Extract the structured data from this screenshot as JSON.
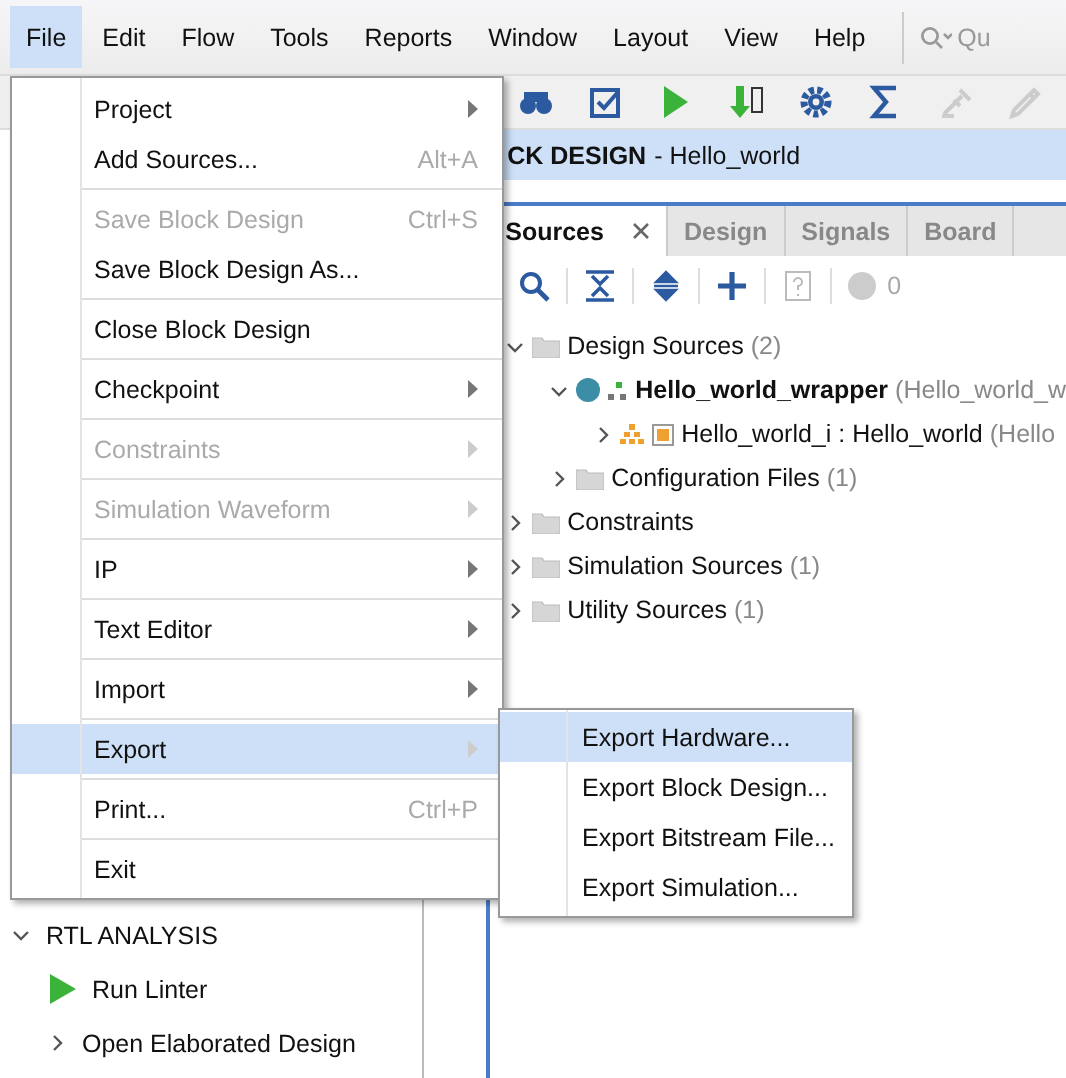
{
  "menubar": {
    "items": [
      {
        "label": "File",
        "selected": true
      },
      {
        "label": "Edit",
        "selected": false
      },
      {
        "label": "Flow",
        "selected": false
      },
      {
        "label": "Tools",
        "selected": false
      },
      {
        "label": "Reports",
        "selected": false
      },
      {
        "label": "Window",
        "selected": false
      },
      {
        "label": "Layout",
        "selected": false
      },
      {
        "label": "View",
        "selected": false
      },
      {
        "label": "Help",
        "selected": false
      }
    ],
    "search": {
      "placeholder": "Qu"
    }
  },
  "toolbar": [
    {
      "kind": "binoculars",
      "disabled": false
    },
    {
      "kind": "check",
      "disabled": false
    },
    {
      "kind": "run",
      "disabled": false
    },
    {
      "kind": "bitstream",
      "disabled": false
    },
    {
      "kind": "gear",
      "disabled": false
    },
    {
      "kind": "sigma",
      "disabled": false
    },
    {
      "kind": "probe",
      "disabled": true
    },
    {
      "kind": "pen",
      "disabled": true
    }
  ],
  "header": {
    "title": "CK DESIGN",
    "subtitle": "- Hello_world"
  },
  "flow_navigator": {
    "sections": [
      {
        "label": "RTL ANALYSIS",
        "expanded": true,
        "items": [
          {
            "label": "Run Linter",
            "kind": "run"
          },
          {
            "label": "Open Elaborated Design",
            "kind": "expandable"
          }
        ]
      }
    ]
  },
  "sources": {
    "tabs": [
      {
        "label": "Sources",
        "selected": true,
        "closable": true
      },
      {
        "label": "Design",
        "selected": false,
        "closable": false
      },
      {
        "label": "Signals",
        "selected": false,
        "closable": false
      },
      {
        "label": "Board",
        "selected": false,
        "closable": false
      }
    ],
    "tools": [
      {
        "kind": "search",
        "disabled": false
      },
      {
        "kind": "collapse",
        "disabled": false
      },
      {
        "kind": "expand",
        "disabled": false
      },
      {
        "kind": "add",
        "disabled": false
      },
      {
        "kind": "help",
        "disabled": true
      }
    ],
    "message_count": "0",
    "tree": [
      {
        "kind": "folder",
        "name": "Design Sources",
        "count": "(2)",
        "expanded": true,
        "children": [
          {
            "kind": "module",
            "name": "Hello_world_wrapper",
            "count": "(Hello_world_w",
            "expanded": true,
            "children": [
              {
                "kind": "instance",
                "name": "Hello_world_i : Hello_world",
                "count": "(Hello",
                "expanded": false
              }
            ]
          },
          {
            "kind": "folder",
            "name": "Configuration Files",
            "count": "(1)",
            "expanded": false
          }
        ]
      },
      {
        "kind": "folder",
        "name": "Constraints",
        "expanded": false
      },
      {
        "kind": "folder",
        "name": "Simulation Sources",
        "count": "(1)",
        "expanded": false
      },
      {
        "kind": "folder",
        "name": "Utility Sources",
        "count": "(1)",
        "expanded": false
      }
    ]
  },
  "file_menu": {
    "groups": [
      [
        {
          "label": "Project",
          "submenu": true,
          "disabled": false,
          "selected": false
        },
        {
          "label": "Add Sources...",
          "shortcut": "Alt+A",
          "submenu": false,
          "disabled": false,
          "selected": false
        }
      ],
      [
        {
          "label": "Save Block Design",
          "shortcut": "Ctrl+S",
          "submenu": false,
          "disabled": true,
          "selected": false
        },
        {
          "label": "Save Block Design As...",
          "submenu": false,
          "disabled": false,
          "selected": false
        }
      ],
      [
        {
          "label": "Close Block Design",
          "submenu": false,
          "disabled": false,
          "selected": false
        }
      ],
      [
        {
          "label": "Checkpoint",
          "submenu": true,
          "disabled": false,
          "selected": false
        }
      ],
      [
        {
          "label": "Constraints",
          "submenu": true,
          "disabled": true,
          "selected": false
        }
      ],
      [
        {
          "label": "Simulation Waveform",
          "submenu": true,
          "disabled": true,
          "selected": false
        }
      ],
      [
        {
          "label": "IP",
          "submenu": true,
          "disabled": false,
          "selected": false
        }
      ],
      [
        {
          "label": "Text Editor",
          "submenu": true,
          "disabled": false,
          "selected": false
        }
      ],
      [
        {
          "label": "Import",
          "submenu": true,
          "disabled": false,
          "selected": false
        }
      ],
      [
        {
          "label": "Export",
          "submenu": true,
          "disabled": false,
          "selected": true
        }
      ],
      [
        {
          "label": "Print...",
          "shortcut": "Ctrl+P",
          "submenu": false,
          "disabled": false,
          "selected": false
        }
      ],
      [
        {
          "label": "Exit",
          "submenu": false,
          "disabled": false,
          "selected": false
        }
      ]
    ]
  },
  "export_submenu": {
    "items": [
      {
        "label": "Export Hardware...",
        "selected": true
      },
      {
        "label": "Export Block Design...",
        "selected": false
      },
      {
        "label": "Export Bitstream File...",
        "selected": false
      },
      {
        "label": "Export Simulation...",
        "selected": false
      }
    ]
  }
}
